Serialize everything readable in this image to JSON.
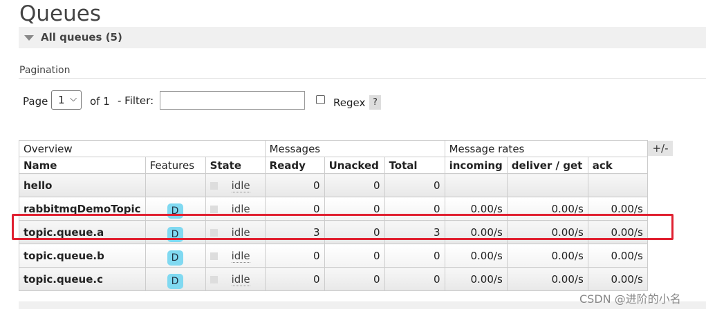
{
  "page": {
    "title": "Queues"
  },
  "section": {
    "label": "All queues (5)"
  },
  "pagination": {
    "label": "Pagination",
    "page_label": "Page",
    "page_value": "1",
    "of_label": "of 1",
    "filter_label": "- Filter:",
    "filter_value": "",
    "regex_label": "Regex",
    "help_label": "?"
  },
  "table": {
    "groups": [
      "Overview",
      "Messages",
      "Message rates"
    ],
    "columns": [
      "Name",
      "Features",
      "State",
      "Ready",
      "Unacked",
      "Total",
      "incoming",
      "deliver / get",
      "ack"
    ],
    "plus_minus": "+/-",
    "rows": [
      {
        "name": "hello",
        "feature": "",
        "state": "idle",
        "ready": "0",
        "unacked": "0",
        "total": "0",
        "incoming": "",
        "deliver": "",
        "ack": ""
      },
      {
        "name": "rabbitmqDemoTopic",
        "feature": "D",
        "state": "idle",
        "ready": "0",
        "unacked": "0",
        "total": "0",
        "incoming": "0.00/s",
        "deliver": "0.00/s",
        "ack": "0.00/s"
      },
      {
        "name": "topic.queue.a",
        "feature": "D",
        "state": "idle",
        "ready": "3",
        "unacked": "0",
        "total": "3",
        "incoming": "0.00/s",
        "deliver": "0.00/s",
        "ack": "0.00/s"
      },
      {
        "name": "topic.queue.b",
        "feature": "D",
        "state": "idle",
        "ready": "0",
        "unacked": "0",
        "total": "0",
        "incoming": "0.00/s",
        "deliver": "0.00/s",
        "ack": "0.00/s"
      },
      {
        "name": "topic.queue.c",
        "feature": "D",
        "state": "idle",
        "ready": "0",
        "unacked": "0",
        "total": "0",
        "incoming": "0.00/s",
        "deliver": "0.00/s",
        "ack": "0.00/s"
      }
    ]
  },
  "watermark": "CSDN @进阶的小名",
  "colors": {
    "highlight": "#e02030",
    "feature_badge": "#80d9f1"
  }
}
